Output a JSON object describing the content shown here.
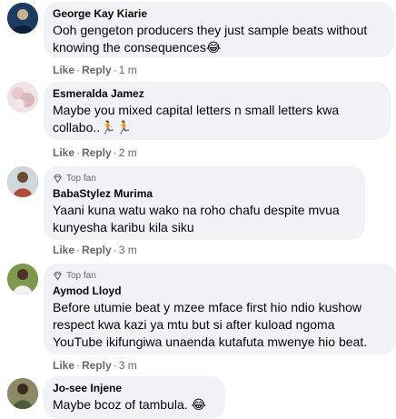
{
  "sep": "·",
  "comments": [
    {
      "author": "George Kay Kiarie",
      "text": "Ooh gengeton producers they just sample beats without knowing the consequences😂",
      "like": "Like",
      "reply": "Reply",
      "time": "1 m",
      "avatar_color": "#1d3a63"
    },
    {
      "author": "Esmeralda Jamez",
      "text": "Maybe you mixed capital letters n small letters kwa collabo..🏃🏃",
      "like": "Like",
      "reply": "Reply",
      "time": "2 m",
      "avatar_color": "#e8d5d8"
    },
    {
      "badge": "Top fan",
      "author": "BabaStylez Murima",
      "text": "Yaani kuna watu wako na roho chafu despite mvua kunyesha karibu kila siku",
      "like": "Like",
      "reply": "Reply",
      "time": "3 m",
      "avatar_color": "#b34a3c"
    },
    {
      "badge": "Top fan",
      "author": "Aymod Lloyd",
      "text": "Before utumie beat y mzee mface first hio ndio kushow respect kwa kazi ya mtu but si after kuload ngoma YouTube ikifungiwa unaenda kutafuta mwenye hio beat.",
      "like": "Like",
      "reply": "Reply",
      "time": "3 m",
      "avatar_color": "#5f7d3a"
    },
    {
      "author": "Jo-see Injene",
      "text": "Maybe bcoz of tambula. 😂",
      "avatar_color": "#6d6b45"
    }
  ]
}
